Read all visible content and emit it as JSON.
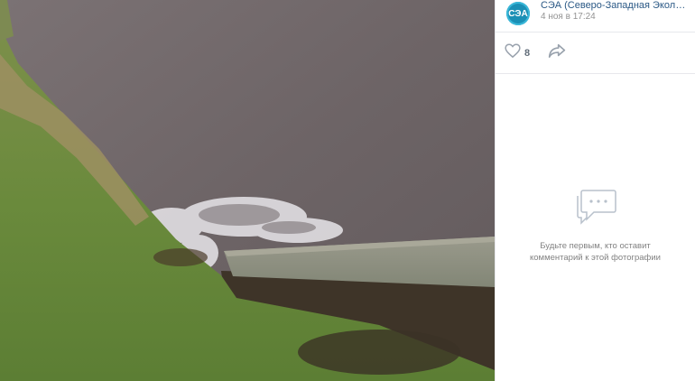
{
  "post": {
    "author": "СЭА (Северо-Западная Экологиче...",
    "avatar_text": "СЭА",
    "date": "4 ноя в 17:24"
  },
  "actions": {
    "like_count": "8",
    "like_icon": "heart-icon",
    "share_icon": "share-arrow-icon"
  },
  "comments": {
    "empty_icon": "comments-bubble-icon",
    "empty_text": "Будьте первым, кто оставит комментарий к этой фотографии"
  },
  "colors": {
    "link": "#2a5885",
    "muted": "#939393",
    "icon": "#99a2ad",
    "avatar": "#1a8fb5"
  }
}
